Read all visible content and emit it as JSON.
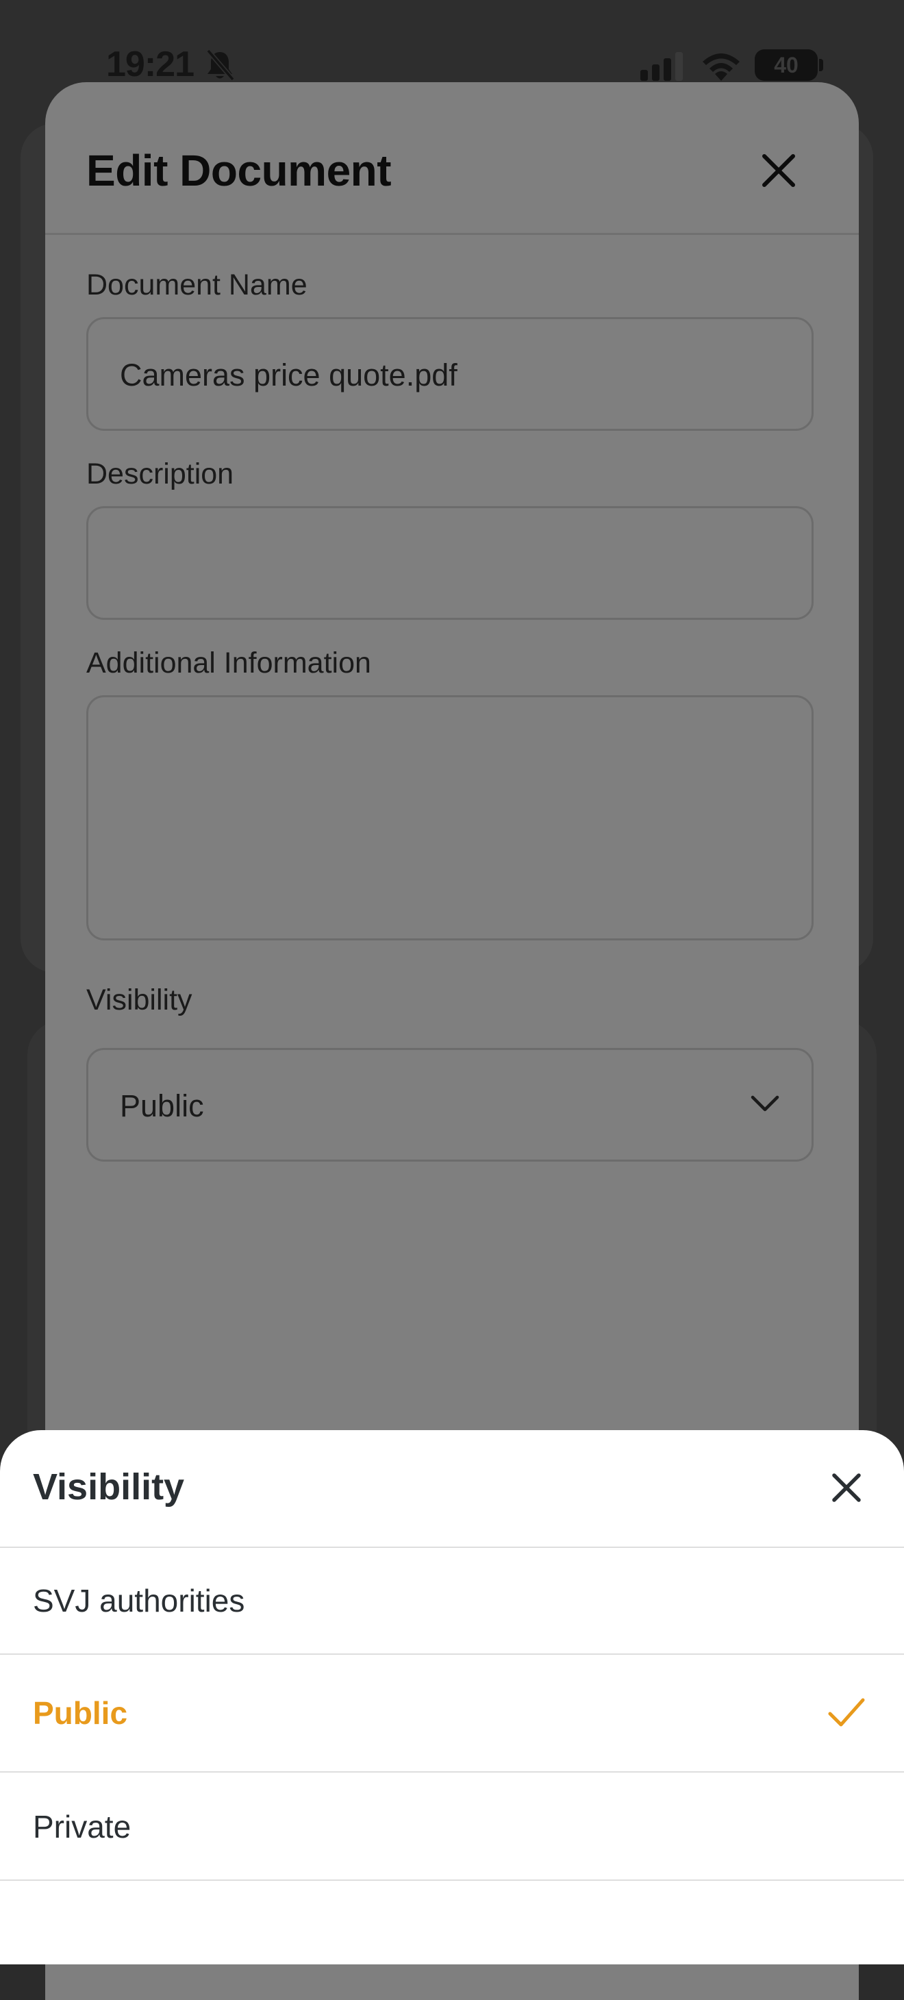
{
  "status_bar": {
    "time": "19:21",
    "battery": "40",
    "icons": [
      "bell-slash-icon",
      "cellular-signal-icon",
      "wifi-icon",
      "battery-icon"
    ]
  },
  "modal": {
    "title": "Edit Document",
    "close_icon": "close-icon",
    "fields": {
      "document_name": {
        "label": "Document Name",
        "value": "Cameras price quote.pdf"
      },
      "description": {
        "label": "Description",
        "value": ""
      },
      "additional_information": {
        "label": "Additional Information",
        "value": ""
      },
      "visibility": {
        "label": "Visibility",
        "value": "Public",
        "icon": "chevron-down-icon"
      }
    }
  },
  "sheet": {
    "title": "Visibility",
    "close_icon": "close-icon",
    "options": [
      {
        "label": "SVJ authorities",
        "selected": false
      },
      {
        "label": "Public",
        "selected": true
      },
      {
        "label": "Private",
        "selected": false
      }
    ],
    "check_icon": "checkmark-icon"
  },
  "colors": {
    "accent": "#e89a1c",
    "overlay_modal": "#7f7f7f",
    "sheet_background": "#ffffff",
    "text_dark": "#2a2f33"
  }
}
